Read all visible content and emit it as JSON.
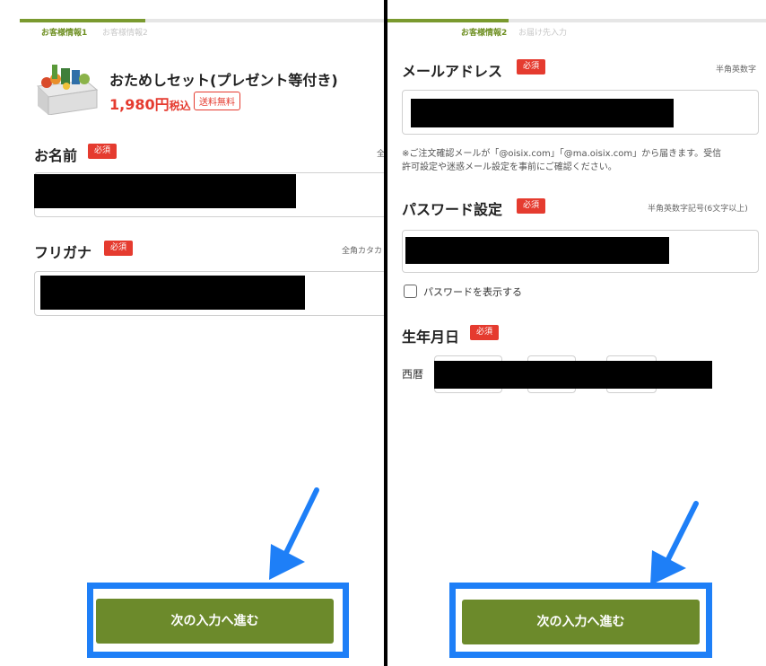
{
  "left": {
    "steps": [
      "お客様情報1",
      "お客様情報2"
    ],
    "progress": 0.35,
    "product": {
      "name": "おためしセット(プレゼント等付き)",
      "price": "1,980円",
      "tax": "税込",
      "shipping_badge": "送料無料"
    },
    "fields": {
      "name": {
        "label": "お名前",
        "required": "必須",
        "hint": "全"
      },
      "furigana": {
        "label": "フリガナ",
        "required": "必須",
        "hint": "全角カタカ"
      }
    },
    "next_button": "次の入力へ進む"
  },
  "right": {
    "steps": [
      "お客様情報2",
      "お届け先入力"
    ],
    "progress": 0.32,
    "fields": {
      "email": {
        "label": "メールアドレス",
        "required": "必須",
        "hint": "半角英数字",
        "note_line1": "※ご注文確認メールが「@oisix.com」「@ma.oisix.com」から届きます。受信",
        "note_line2": "許可設定や迷惑メール設定を事前にご確認ください。"
      },
      "password": {
        "label": "パスワード設定",
        "required": "必須",
        "hint": "半角英数字記号(6文字以上)",
        "show_password": "パスワードを表示する"
      },
      "birthday": {
        "label": "生年月日",
        "required": "必須",
        "era": "西暦"
      }
    },
    "next_button": "次の入力へ進む"
  },
  "colors": {
    "accent_green": "#6c8a2b",
    "required_red": "#e53b2f",
    "highlight_blue": "#1e7ff7"
  },
  "icons": [
    "product-set-image",
    "checkbox-icon",
    "pointer-arrow-icon"
  ]
}
